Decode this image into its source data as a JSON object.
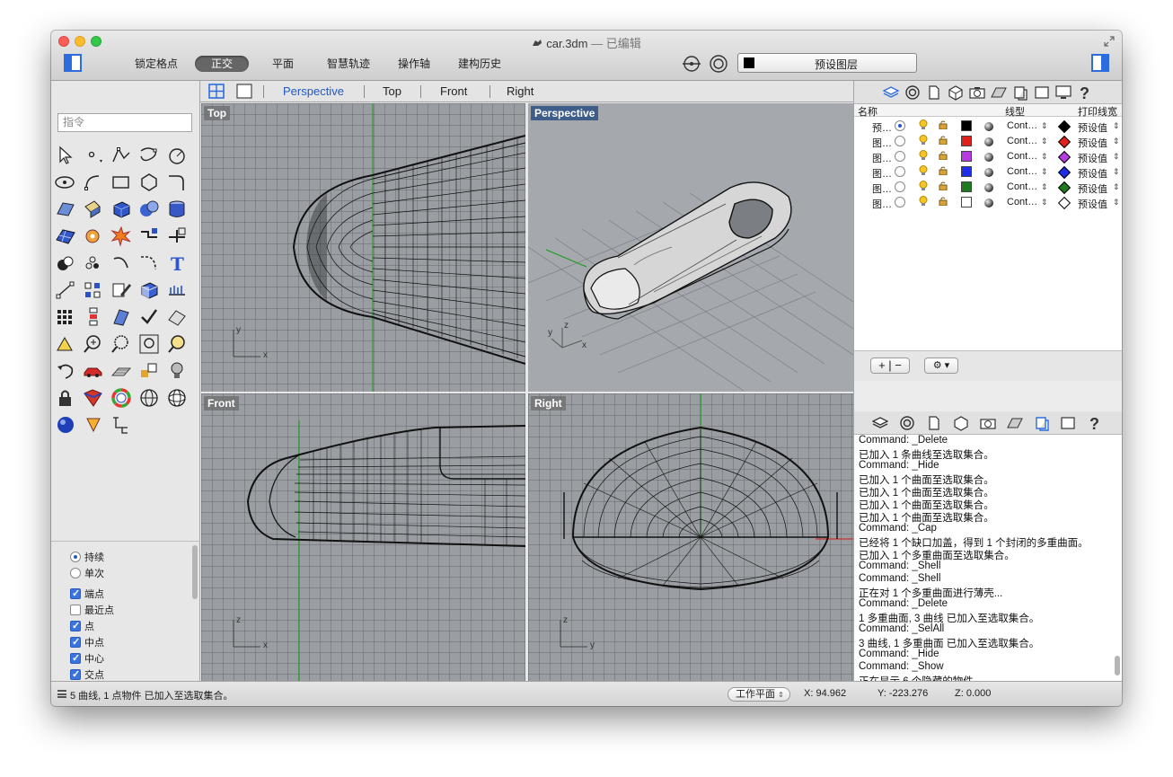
{
  "window": {
    "title": "car.3dm",
    "title_suffix": "— 已编辑"
  },
  "toolbar": {
    "modes": [
      "锁定格点",
      "正交",
      "平面",
      "智慧轨迹",
      "操作轴",
      "建构历史"
    ],
    "active_mode": "正交",
    "current_layer": "预设图层",
    "current_layer_color": "#000000"
  },
  "command": {
    "placeholder": "指令"
  },
  "viewport_tabs": [
    "Perspective",
    "Top",
    "Front",
    "Right"
  ],
  "active_viewport_tab": "Perspective",
  "viewports": {
    "top": "Top",
    "perspective": "Perspective",
    "front": "Front",
    "right": "Right"
  },
  "axis_labels": {
    "x": "x",
    "y": "y",
    "z": "z"
  },
  "osnap": {
    "items": [
      {
        "label": "持续",
        "type": "radio",
        "checked": true
      },
      {
        "label": "单次",
        "type": "radio",
        "checked": false
      },
      {
        "label": "端点",
        "type": "check",
        "checked": true
      },
      {
        "label": "最近点",
        "type": "check",
        "checked": false
      },
      {
        "label": "点",
        "type": "check",
        "checked": true
      },
      {
        "label": "中点",
        "type": "check",
        "checked": true
      },
      {
        "label": "中心",
        "type": "check",
        "checked": true
      },
      {
        "label": "交点",
        "type": "check",
        "checked": true
      }
    ]
  },
  "layers": {
    "headers": {
      "name": "名称",
      "linetype": "线型",
      "print_width": "打印线宽"
    },
    "rows": [
      {
        "name": "预…",
        "current": true,
        "color": "#000000",
        "linetype": "Cont…",
        "diamond": "#000000",
        "width": "预设值"
      },
      {
        "name": "图…",
        "current": false,
        "color": "#e0201c",
        "linetype": "Cont…",
        "diamond": "#e0201c",
        "width": "预设值"
      },
      {
        "name": "图…",
        "current": false,
        "color": "#b63be0",
        "linetype": "Cont…",
        "diamond": "#b63be0",
        "width": "预设值"
      },
      {
        "name": "图…",
        "current": false,
        "color": "#1f2ee6",
        "linetype": "Cont…",
        "diamond": "#1f2ee6",
        "width": "预设值"
      },
      {
        "name": "图…",
        "current": false,
        "color": "#1f7a1f",
        "linetype": "Cont…",
        "diamond": "#1f7a1f",
        "width": "预设值"
      },
      {
        "name": "图…",
        "current": false,
        "color": "#ffffff",
        "linetype": "Cont…",
        "diamond": "#ffffff",
        "width": "预设值"
      }
    ],
    "footer": {
      "add_remove": "+ | −",
      "gear": "⚙ ▾"
    }
  },
  "history": [
    "Command: _Delete",
    "已加入 1 条曲线至选取集合。",
    "Command: _Hide",
    "已加入 1 个曲面至选取集合。",
    "已加入 1 个曲面至选取集合。",
    "已加入 1 个曲面至选取集合。",
    "已加入 1 个曲面至选取集合。",
    "Command: _Cap",
    "已经将 1 个缺口加盖，得到 1 个封闭的多重曲面。",
    "已加入 1 个多重曲面至选取集合。",
    "Command: _Shell",
    "Command: _Shell",
    "正在对 1 个多重曲面进行薄壳...",
    "Command: _Delete",
    "1 多重曲面, 3 曲线 已加入至选取集合。",
    "Command: _SelAll",
    "3 曲线, 1 多重曲面 已加入至选取集合。",
    "Command: _Hide",
    "Command: _Show",
    "正在显示 6 个隐藏的物件。",
    "5 曲线, 1 点物件 已加入至选取集合。"
  ],
  "status": {
    "message": "5 曲线, 1 点物件 已加入至选取集合。",
    "cplane": "工作平面",
    "x": "X: 94.962",
    "y": "Y: -223.276",
    "z": "Z: 0.000"
  }
}
